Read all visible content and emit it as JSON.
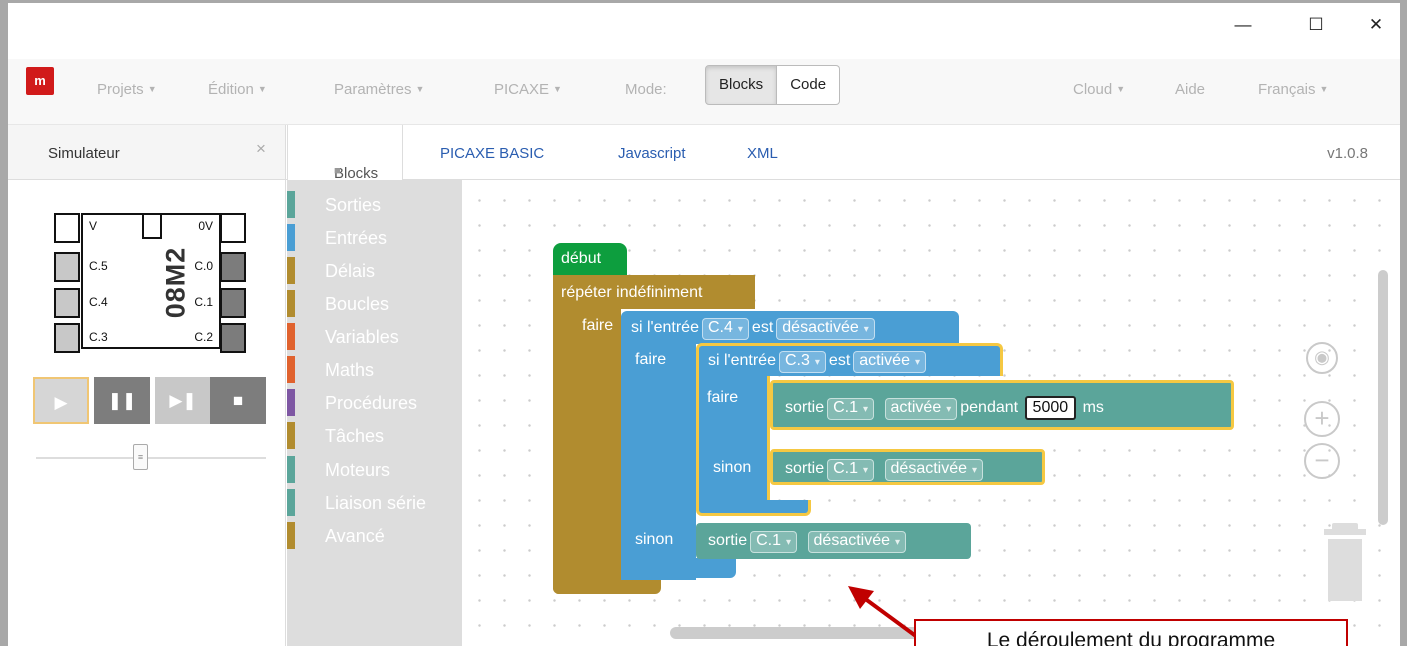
{
  "window_controls": {
    "minimize": "—",
    "maximize": "☐",
    "close": "✕"
  },
  "navbar": {
    "logo_text": "m",
    "menus": [
      "Projets",
      "Édition",
      "Paramètres",
      "PICAXE"
    ],
    "mode_label": "Mode:",
    "mode_buttons": [
      "Blocks",
      "Code"
    ],
    "right_menus": [
      "Cloud",
      "Aide",
      "Français"
    ]
  },
  "tabs": {
    "simulator_title": "Simulateur",
    "simulator_close": "×",
    "items": [
      "Blocks",
      "PICAXE BASIC",
      "Javascript",
      "XML"
    ],
    "lock_icon": "🔒",
    "version": "v1.0.8"
  },
  "chip": {
    "name": "08M2",
    "left_pins": [
      "V",
      "C.5",
      "C.4",
      "C.3"
    ],
    "right_pins": [
      "0V",
      "C.0",
      "C.1",
      "C.2"
    ]
  },
  "sim_controls": {
    "play": "▶",
    "pause": "❚❚",
    "step": "▶❚",
    "stop": "■"
  },
  "toolbox": {
    "categories": [
      {
        "label": "Sorties",
        "color": "#5ba59a"
      },
      {
        "label": "Entrées",
        "color": "#4a9ed4"
      },
      {
        "label": "Délais",
        "color": "#b18c2f"
      },
      {
        "label": "Boucles",
        "color": "#b18c2f"
      },
      {
        "label": "Variables",
        "color": "#e0622e"
      },
      {
        "label": "Maths",
        "color": "#e0622e"
      },
      {
        "label": "Procédures",
        "color": "#7e57a3"
      },
      {
        "label": "Tâches",
        "color": "#b18c2f"
      },
      {
        "label": "Moteurs",
        "color": "#5ba59a"
      },
      {
        "label": "Liaison série",
        "color": "#5ba59a"
      },
      {
        "label": "Avancé",
        "color": "#b18c2f"
      }
    ]
  },
  "blocks": {
    "start": "début",
    "loop": "répéter indéfiniment",
    "do": "faire",
    "else": "sinon",
    "if_input": "si l'entrée",
    "is": "est",
    "pin_c4": "C.4",
    "pin_c3": "C.3",
    "pin_c1": "C.1",
    "state_off": "désactivée",
    "state_on": "activée",
    "output": "sortie",
    "during": "pendant",
    "duration": "5000",
    "unit": "ms"
  },
  "callout": {
    "text": "Le déroulement du programme"
  }
}
